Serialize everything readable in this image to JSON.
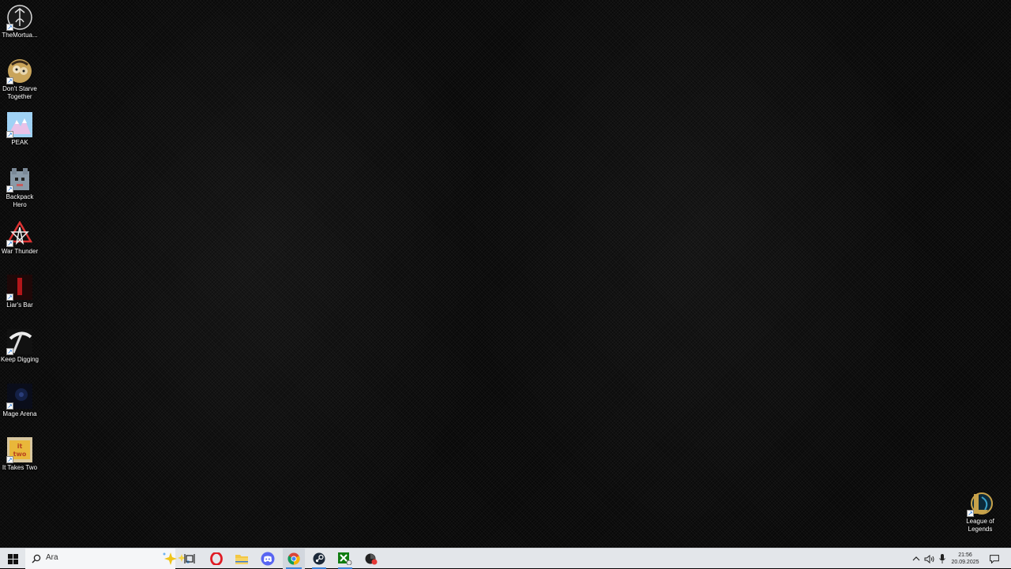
{
  "desktop": {
    "icons": [
      {
        "label": "TheMortua..."
      },
      {
        "label": "Don't Starve Together"
      },
      {
        "label": "PEAK"
      },
      {
        "label": "Backpack Hero"
      },
      {
        "label": "War Thunder"
      },
      {
        "label": "Liar's Bar"
      },
      {
        "label": "Keep Digging"
      },
      {
        "label": "Mage Arena"
      },
      {
        "label": "It Takes Two"
      },
      {
        "label": "League of Legends"
      }
    ]
  },
  "taskbar": {
    "search_placeholder": "Ara",
    "clock": {
      "time": "21:56",
      "date": "20.09.2025"
    }
  },
  "colors": {
    "taskbar_bg": "#e3e6ea",
    "accent": "#3b82d9"
  }
}
